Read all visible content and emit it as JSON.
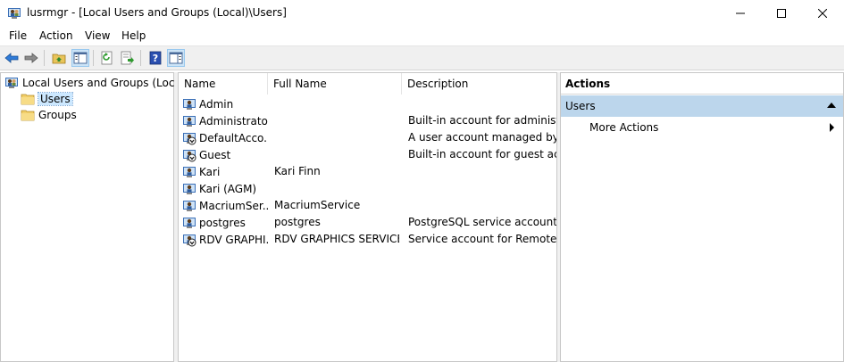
{
  "window": {
    "title": "lusrmgr - [Local Users and Groups (Local)\\Users]",
    "controls": [
      "minimize",
      "maximize",
      "close"
    ]
  },
  "menu": {
    "items": [
      "File",
      "Action",
      "View",
      "Help"
    ]
  },
  "toolbar": {
    "buttons": [
      "back-arrow-icon",
      "forward-arrow-icon",
      "up-folder-icon",
      "show-hide-console-tree-icon",
      "refresh-icon",
      "export-list-icon",
      "help-icon",
      "show-hide-action-pane-icon"
    ]
  },
  "tree": {
    "root": "Local Users and Groups (Local)",
    "children": [
      "Users",
      "Groups"
    ],
    "selected": "Users"
  },
  "list": {
    "columns": [
      "Name",
      "Full Name",
      "Description"
    ],
    "rows": [
      {
        "name": "Admin",
        "full_name": "",
        "description": "",
        "disabled": false
      },
      {
        "name": "Administrator",
        "full_name": "",
        "description": "Built-in account for administeri",
        "disabled": false
      },
      {
        "name": "DefaultAcco...",
        "full_name": "",
        "description": "A user account managed by the",
        "disabled": true
      },
      {
        "name": "Guest",
        "full_name": "",
        "description": "Built-in account for guest acces",
        "disabled": true
      },
      {
        "name": "Kari",
        "full_name": "Kari Finn",
        "description": "",
        "disabled": false
      },
      {
        "name": "Kari (AGM)",
        "full_name": "",
        "description": "",
        "disabled": false
      },
      {
        "name": "MacriumSer...",
        "full_name": "MacriumService",
        "description": "",
        "disabled": false
      },
      {
        "name": "postgres",
        "full_name": "postgres",
        "description": "PostgreSQL service account",
        "disabled": false
      },
      {
        "name": "RDV GRAPHI...",
        "full_name": "RDV GRAPHICS SERVICE",
        "description": "Service account for Remote Des",
        "disabled": true
      }
    ]
  },
  "actions": {
    "title": "Actions",
    "section": "Users",
    "items": [
      "More Actions"
    ]
  },
  "colors": {
    "selection": "#cce8ff",
    "actions_section": "#bcd6ec",
    "toolbar": "#f0f0f0"
  }
}
